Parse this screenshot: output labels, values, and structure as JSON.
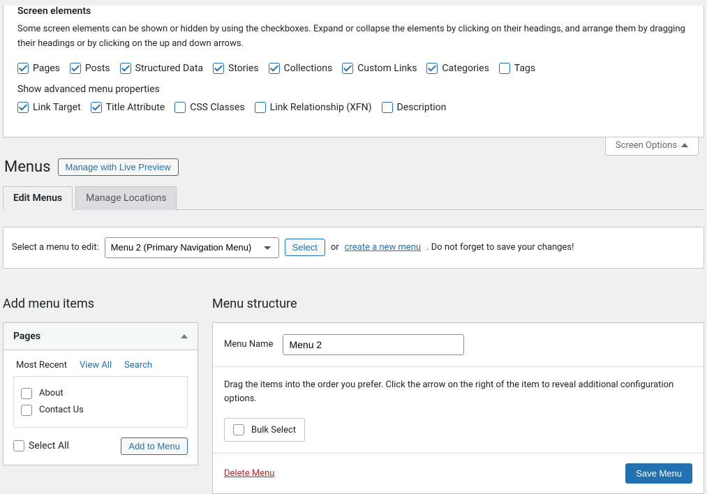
{
  "screenOptions": {
    "heading": "Screen elements",
    "description": "Some screen elements can be shown or hidden by using the checkboxes. Expand or collapse the elements by clicking on their headings, and arrange them by dragging their headings or by clicking on the up and down arrows.",
    "boxes": [
      {
        "label": "Pages",
        "checked": true
      },
      {
        "label": "Posts",
        "checked": true
      },
      {
        "label": "Structured Data",
        "checked": true
      },
      {
        "label": "Stories",
        "checked": true
      },
      {
        "label": "Collections",
        "checked": true
      },
      {
        "label": "Custom Links",
        "checked": true
      },
      {
        "label": "Categories",
        "checked": true
      },
      {
        "label": "Tags",
        "checked": false
      }
    ],
    "advancedLabel": "Show advanced menu properties",
    "advanced": [
      {
        "label": "Link Target",
        "checked": true
      },
      {
        "label": "Title Attribute",
        "checked": true
      },
      {
        "label": "CSS Classes",
        "checked": false
      },
      {
        "label": "Link Relationship (XFN)",
        "checked": false
      },
      {
        "label": "Description",
        "checked": false
      }
    ],
    "tabLabel": "Screen Options"
  },
  "page": {
    "title": "Menus",
    "livePreview": "Manage with Live Preview"
  },
  "tabs": {
    "edit": "Edit Menus",
    "manage": "Manage Locations"
  },
  "selector": {
    "label": "Select a menu to edit:",
    "selected": "Menu 2 (Primary Navigation Menu)",
    "selectBtn": "Select",
    "or": "or",
    "create": "create a new menu",
    "tail": ". Do not forget to save your changes!"
  },
  "left": {
    "heading": "Add menu items",
    "pagesTitle": "Pages",
    "innerTabs": {
      "recent": "Most Recent",
      "viewAll": "View All",
      "search": "Search"
    },
    "items": [
      {
        "label": "About",
        "checked": false
      },
      {
        "label": "Contact Us",
        "checked": false
      }
    ],
    "selectAll": "Select All",
    "addBtn": "Add to Menu"
  },
  "right": {
    "heading": "Menu structure",
    "nameLabel": "Menu Name",
    "nameValue": "Menu 2",
    "desc": "Drag the items into the order you prefer. Click the arrow on the right of the item to reveal additional configuration options.",
    "bulk": "Bulk Select",
    "delete": "Delete Menu",
    "save": "Save Menu"
  }
}
